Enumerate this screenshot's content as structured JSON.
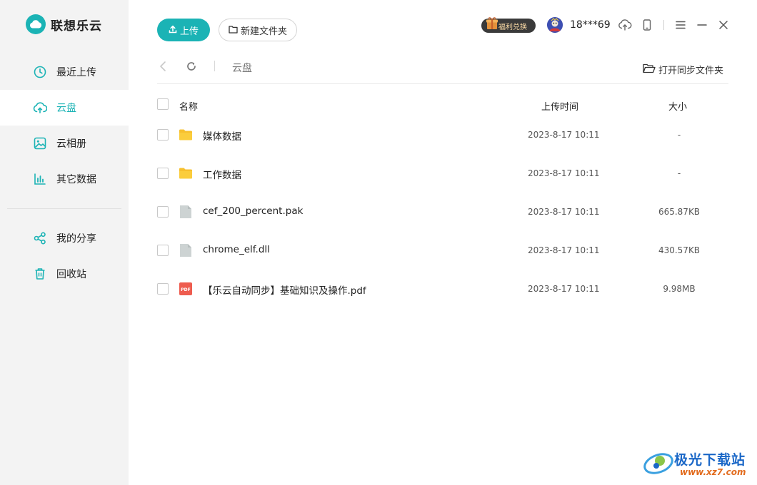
{
  "app": {
    "name": "联想乐云"
  },
  "sidebar": {
    "items": [
      {
        "label": "最近上传",
        "icon": "clock-icon",
        "active": false
      },
      {
        "label": "云盘",
        "icon": "cloud-upload-icon",
        "active": true
      },
      {
        "label": "云相册",
        "icon": "image-icon",
        "active": false
      },
      {
        "label": "其它数据",
        "icon": "bar-chart-icon",
        "active": false
      },
      {
        "label": "我的分享",
        "icon": "share-icon",
        "active": false
      },
      {
        "label": "回收站",
        "icon": "trash-icon",
        "active": false
      }
    ]
  },
  "toolbar": {
    "upload_label": "上传",
    "new_folder_label": "新建文件夹",
    "welfare_label": "福利兑换",
    "username": "18***69"
  },
  "navbar": {
    "breadcrumb": "云盘",
    "open_sync_label": "打开同步文件夹"
  },
  "table": {
    "headers": {
      "name": "名称",
      "time": "上传时间",
      "size": "大小"
    },
    "rows": [
      {
        "name": "媒体数据",
        "time": "2023-8-17 10:11",
        "size": "-",
        "type": "folder-icon"
      },
      {
        "name": "工作数据",
        "time": "2023-8-17 10:11",
        "size": "-",
        "type": "folder-icon"
      },
      {
        "name": "cef_200_percent.pak",
        "time": "2023-8-17 10:11",
        "size": "665.87KB",
        "type": "file-icon"
      },
      {
        "name": "chrome_elf.dll",
        "time": "2023-8-17 10:11",
        "size": "430.57KB",
        "type": "file-icon"
      },
      {
        "name": "【乐云自动同步】基础知识及操作.pdf",
        "time": "2023-8-17 10:11",
        "size": "9.98MB",
        "type": "pdf-icon"
      }
    ]
  },
  "watermark": {
    "text": "极光下载站",
    "url": "www.xz7.com"
  },
  "colors": {
    "accent": "#1bb3b5",
    "sidebar_bg": "#f3f3f3",
    "folder": "#f7c02e",
    "pdf": "#ee5c4f"
  }
}
